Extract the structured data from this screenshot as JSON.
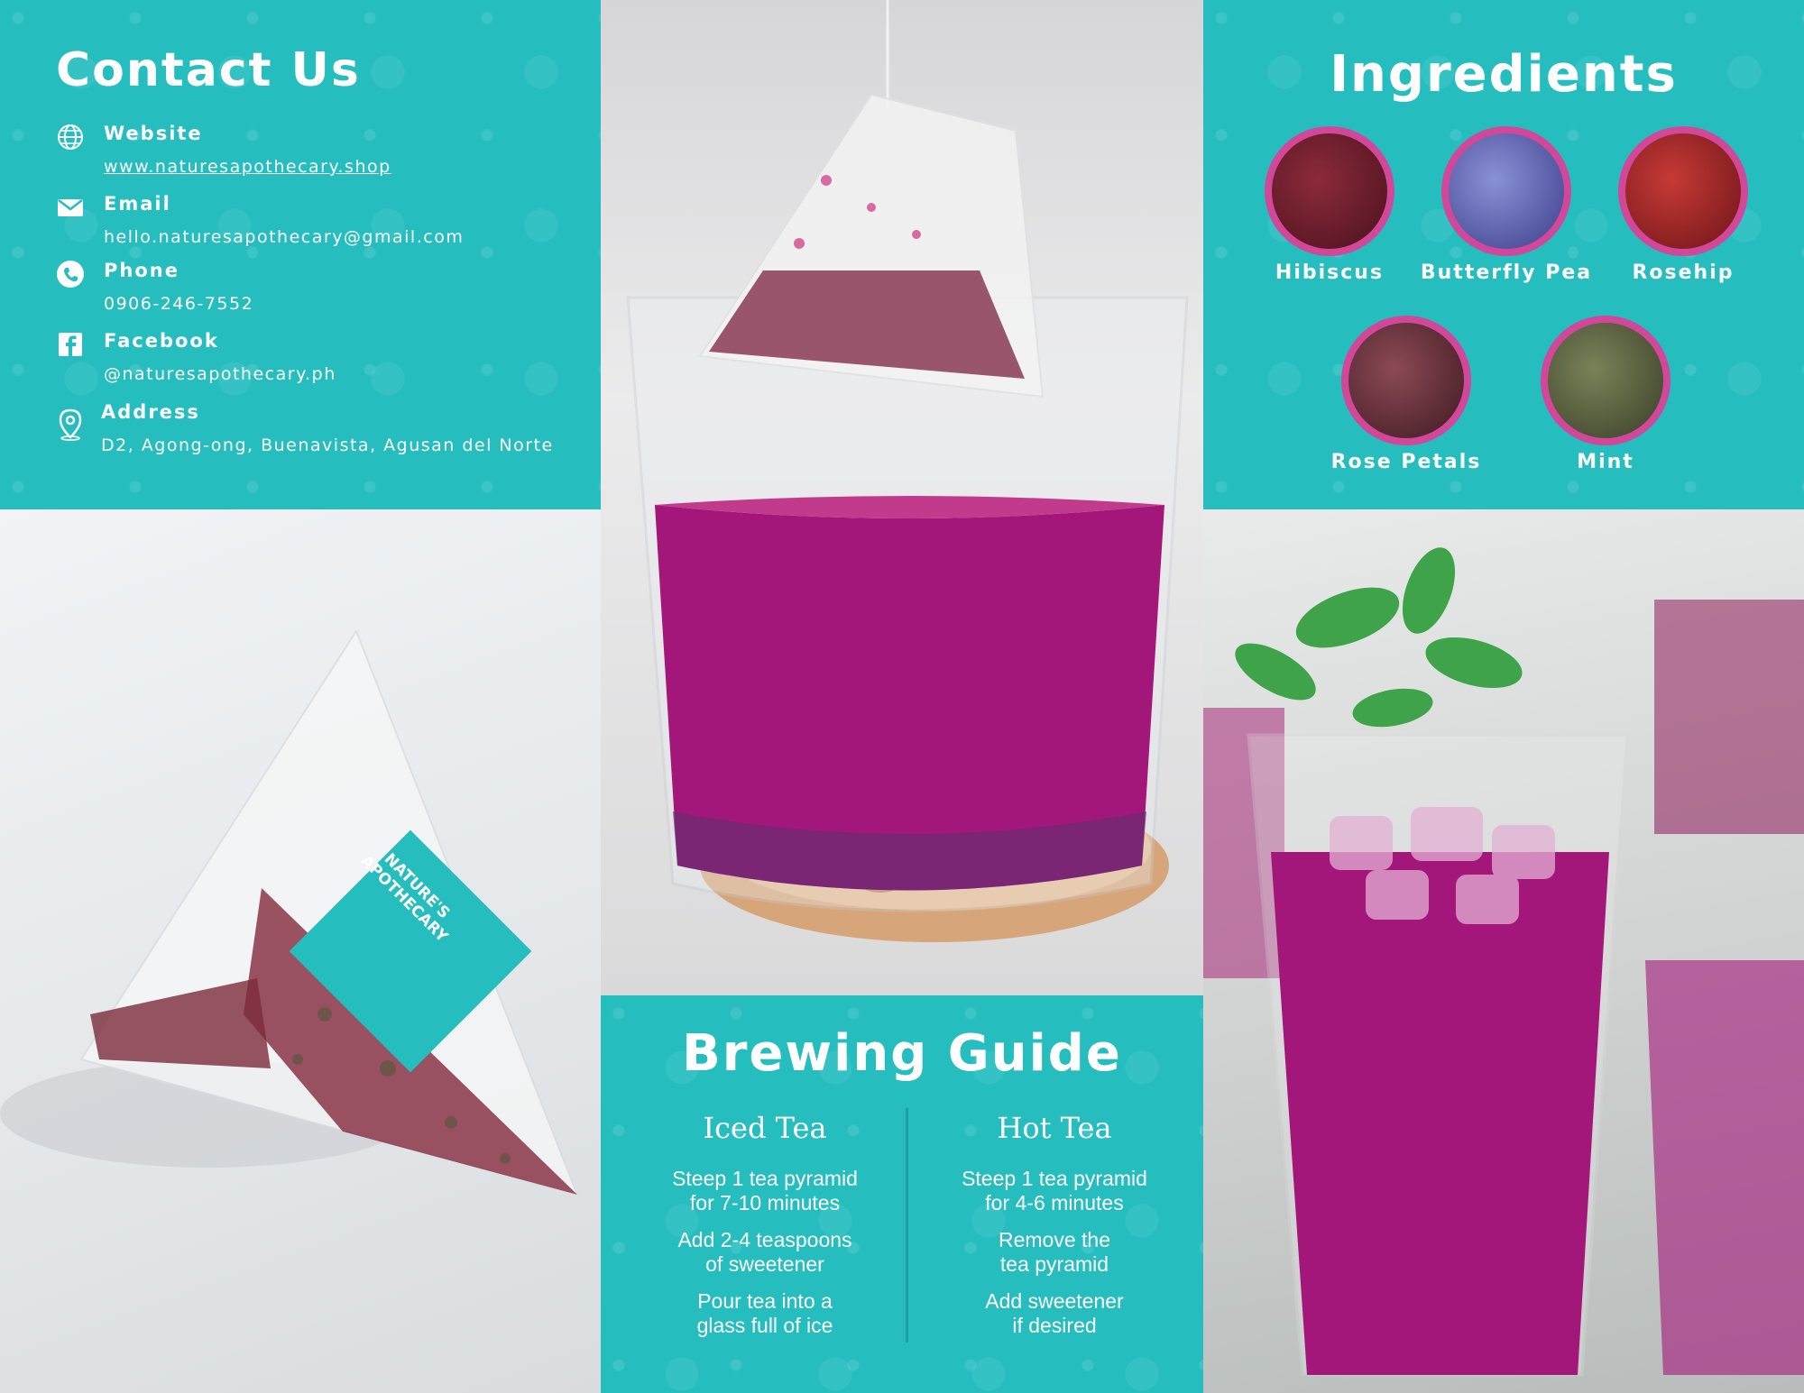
{
  "contact": {
    "title": "Contact Us",
    "website": {
      "label": "Website",
      "value": "www.naturesapothecary.shop",
      "icon": "globe-icon"
    },
    "email": {
      "label": "Email",
      "value": "hello.naturesapothecary@gmail.com",
      "icon": "envelope-icon"
    },
    "phone": {
      "label": "Phone",
      "value": "0906-246-7552",
      "icon": "phone-icon"
    },
    "facebook": {
      "label": "Facebook",
      "value": "@naturesapothecary.ph",
      "icon": "facebook-icon"
    },
    "address": {
      "label": "Address",
      "value": "D2, Agong-ong, Buenavista, Agusan del Norte",
      "icon": "map-pin-icon"
    }
  },
  "brand": {
    "line1": "NATURE'S",
    "line2": "APOTHECARY"
  },
  "brewing": {
    "title": "Brewing Guide",
    "iced": {
      "heading": "Iced Tea",
      "steps": [
        "Steep 1 tea pyramid\nfor 7-10 minutes",
        "Add 2-4 teaspoons\nof sweetener",
        "Pour tea into a\nglass full of ice"
      ]
    },
    "hot": {
      "heading": "Hot Tea",
      "steps": [
        "Steep 1 tea pyramid\nfor 4-6 minutes",
        "Remove the\ntea pyramid",
        "Add sweetener\nif desired"
      ]
    }
  },
  "ingredients": {
    "title": "Ingredients",
    "items": [
      {
        "name": "Hibiscus",
        "color": "#6a1f2c"
      },
      {
        "name": "Butterfly Pea",
        "color": "#5b63b5"
      },
      {
        "name": "Rosehip",
        "color": "#a8262a"
      },
      {
        "name": "Rose Petals",
        "color": "#6b3540"
      },
      {
        "name": "Mint",
        "color": "#5d6445"
      }
    ]
  },
  "colors": {
    "teal": "#26bdbf",
    "magenta_ring": "#d1479a",
    "tea": "#a3167a"
  }
}
